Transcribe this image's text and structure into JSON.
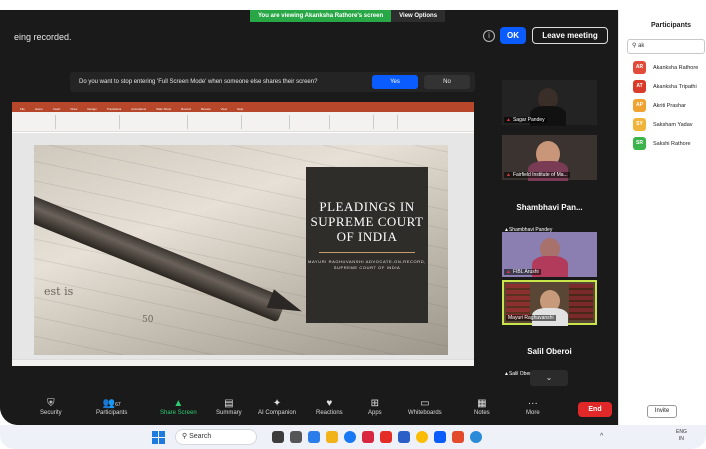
{
  "banner": {
    "viewing": "You are viewing Akanksha Rathore's screen",
    "options": "View Options"
  },
  "topbar": {
    "recording": "eing recorded.",
    "ok": "OK",
    "leave": "Leave meeting"
  },
  "fullscreen_prompt": {
    "question": "Do you want to stop entering 'Full Screen Mode' when someone else shares their screen?",
    "yes": "Yes",
    "no": "No"
  },
  "shared_slide": {
    "title": "PLEADINGS IN SUPREME COURT OF INDIA",
    "byline": "MAYURI RAGHUVANSHI ADVOCATE-ON-RECORD, SUPREME COURT OF INDIA",
    "bg_numbers": [
      "est is",
      "50"
    ]
  },
  "gallery": {
    "tiles": [
      {
        "name": "Sagar Pandey"
      },
      {
        "name": "Fairfield Institute of Ma..."
      },
      {
        "big": "Shambhavi Pan...",
        "name": "Shambhavi Pandey"
      },
      {
        "name": "FIBL Arushi"
      },
      {
        "name": "Mayuri Raghuvanshi"
      },
      {
        "big": "Salil Oberoi",
        "name": "Salil Oberoi"
      }
    ],
    "more": "⌄"
  },
  "toolbar": {
    "items": [
      {
        "label": "Security",
        "icon": "shield-icon",
        "glyph": "⛨"
      },
      {
        "label": "Participants",
        "icon": "people-icon",
        "glyph": "👥",
        "count": "67"
      },
      {
        "label": "Share Screen",
        "icon": "share-icon",
        "glyph": "▲"
      },
      {
        "label": "Summary",
        "icon": "summary-icon",
        "glyph": "▤"
      },
      {
        "label": "AI Companion",
        "icon": "sparkle-icon",
        "glyph": "✦"
      },
      {
        "label": "Reactions",
        "icon": "reactions-icon",
        "glyph": "♥"
      },
      {
        "label": "Apps",
        "icon": "apps-icon",
        "glyph": "⊞"
      },
      {
        "label": "Whiteboards",
        "icon": "whiteboard-icon",
        "glyph": "▭"
      },
      {
        "label": "Notes",
        "icon": "notes-icon",
        "glyph": "▦"
      },
      {
        "label": "More",
        "icon": "more-icon",
        "glyph": "···"
      }
    ],
    "end": "End"
  },
  "panel": {
    "header": "Participants",
    "search": "ak",
    "participants": [
      {
        "initials": "AR",
        "name": "Akanksha Rathore",
        "color": "#e04b3a"
      },
      {
        "initials": "AT",
        "name": "Akanksha Tripathi",
        "color": "#d93a2a"
      },
      {
        "initials": "AP",
        "name": "Akriti Prashar",
        "color": "#f0a330"
      },
      {
        "initials": "SY",
        "name": "Saksham Yadav",
        "color": "#f0b43a"
      },
      {
        "initials": "SR",
        "name": "Sakshi Rathore",
        "color": "#3cb44b"
      }
    ],
    "invite": "Invite"
  },
  "taskbar": {
    "search": "Search",
    "lang": "ENG",
    "region": "IN"
  },
  "colors": {
    "zoom_blue": "#0b5cff",
    "end_red": "#e02828",
    "share_green": "#27a745"
  }
}
